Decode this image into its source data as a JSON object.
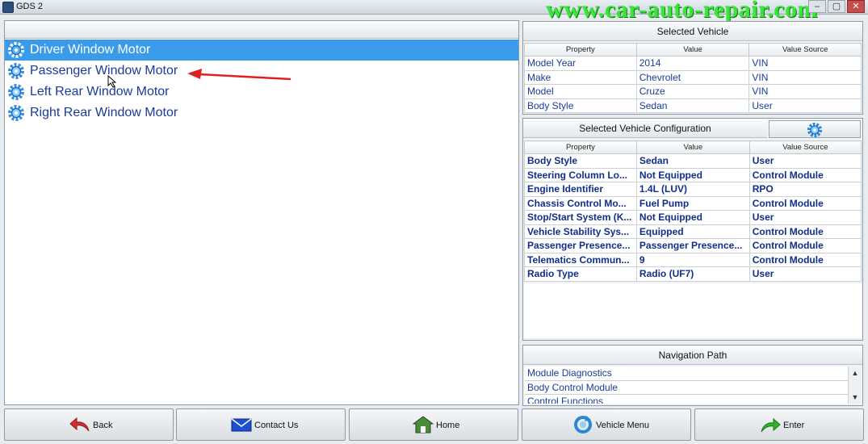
{
  "window": {
    "title": "GDS 2",
    "watermark": "www.car-auto-repair.com",
    "controls": {
      "minimize": "–",
      "maximize": "▢",
      "close": "✕"
    }
  },
  "list": {
    "items": [
      {
        "label": "Driver Window Motor",
        "icon": "gear-icon",
        "selected": true
      },
      {
        "label": "Passenger Window Motor",
        "icon": "gear-icon",
        "selected": false
      },
      {
        "label": "Left Rear Window Motor",
        "icon": "gear-icon",
        "selected": false
      },
      {
        "label": "Right Rear Window Motor",
        "icon": "gear-icon",
        "selected": false
      }
    ]
  },
  "selected_vehicle": {
    "title": "Selected Vehicle",
    "headers": [
      "Property",
      "Value",
      "Value Source"
    ],
    "rows": [
      [
        "Model Year",
        "2014",
        "VIN"
      ],
      [
        "Make",
        "Chevrolet",
        "VIN"
      ],
      [
        "Model",
        "Cruze",
        "VIN"
      ],
      [
        "Body Style",
        "Sedan",
        "User"
      ]
    ]
  },
  "vehicle_config": {
    "title": "Selected Vehicle Configuration",
    "headers": [
      "Property",
      "Value",
      "Value Source"
    ],
    "rows": [
      [
        "Body Style",
        "Sedan",
        "User"
      ],
      [
        "Steering Column Lo...",
        "Not Equipped",
        "Control Module"
      ],
      [
        "Engine Identifier",
        "1.4L (LUV)",
        "RPO"
      ],
      [
        "Chassis Control Mo...",
        "Fuel Pump",
        "Control Module"
      ],
      [
        "Stop/Start System (K...",
        "Not Equipped",
        "User"
      ],
      [
        "Vehicle Stability Sys...",
        "Equipped",
        "Control Module"
      ],
      [
        "Passenger Presence...",
        "Passenger Presence...",
        "Control Module"
      ],
      [
        "Telematics Commun...",
        "9",
        "Control Module"
      ],
      [
        "Radio Type",
        "Radio (UF7)",
        "User"
      ]
    ]
  },
  "navigation": {
    "title": "Navigation Path",
    "items": [
      "Module Diagnostics",
      "Body Control Module",
      "Control Functions"
    ]
  },
  "buttons": {
    "back": "Back",
    "contact": "Contact Us",
    "home": "Home",
    "vehicle_menu": "Vehicle Menu",
    "enter": "Enter"
  },
  "colors": {
    "selection": "#3a9bea",
    "link_text": "#1a3b9a",
    "annotation_arrow": "#e02020",
    "watermark": "#39e639"
  }
}
